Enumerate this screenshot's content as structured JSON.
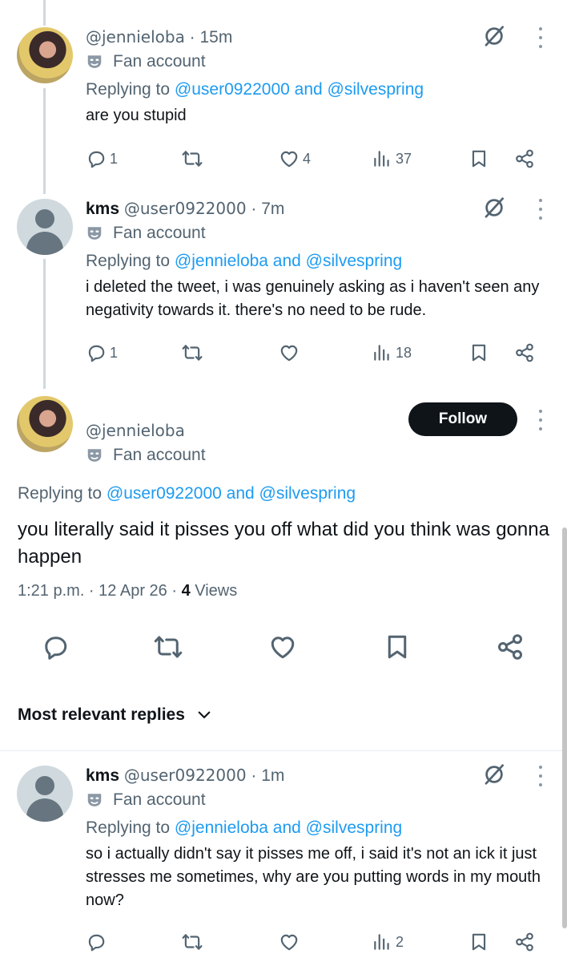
{
  "thread": [
    {
      "display_name": "",
      "handle": "@jennieloba",
      "time": "· 15m",
      "label": "Fan account",
      "replying_prefix": "Replying to",
      "replying_targets": "@user0922000 and @silvespring",
      "text": "are you stupid",
      "replies": "1",
      "reposts": "",
      "likes": "4",
      "views": "37"
    },
    {
      "display_name": "kms",
      "handle": "@user0922000",
      "time": "· 7m",
      "label": "Fan account",
      "replying_prefix": "Replying to",
      "replying_targets": "@jennieloba and @silvespring",
      "text": "i deleted the tweet, i was genuinely asking as i haven't seen any negativity towards it. there's no need to be rude.",
      "replies": "1",
      "reposts": "",
      "likes": "",
      "views": "18"
    }
  ],
  "focused": {
    "display_name": "",
    "handle": "@jennieloba",
    "label": "Fan account",
    "follow_label": "Follow",
    "replying_prefix": "Replying to",
    "replying_targets": "@user0922000 and @silvespring",
    "text": "you literally said it pisses you off what did you think was gonna happen",
    "timestamp": "1:21 p.m. · 12 Apr 26 · ",
    "views_count": "4",
    "views_label": " Views"
  },
  "replies_section": {
    "title": "Most relevant replies"
  },
  "reply": {
    "display_name": "kms",
    "handle": "@user0922000",
    "time": "· 1m",
    "label": "Fan account",
    "replying_prefix": "Replying to",
    "replying_targets": "@jennieloba and @silvespring",
    "text": "so i actually didn't say it pisses me off, i said it's not an ick it just stresses me sometimes, why are you putting words in my mouth now?",
    "replies": "",
    "reposts": "",
    "likes": "",
    "views": "2"
  },
  "colors": {
    "link": "#1d9bf0",
    "secondary_text": "#536471",
    "primary_text": "#0f1419",
    "follow_button": "#0f1419"
  },
  "icons": [
    "reply-icon",
    "repost-icon",
    "like-icon",
    "views-icon",
    "bookmark-icon",
    "share-icon",
    "grok-icon",
    "more-icon",
    "fan-account-mask-icon",
    "chevron-down-icon"
  ]
}
